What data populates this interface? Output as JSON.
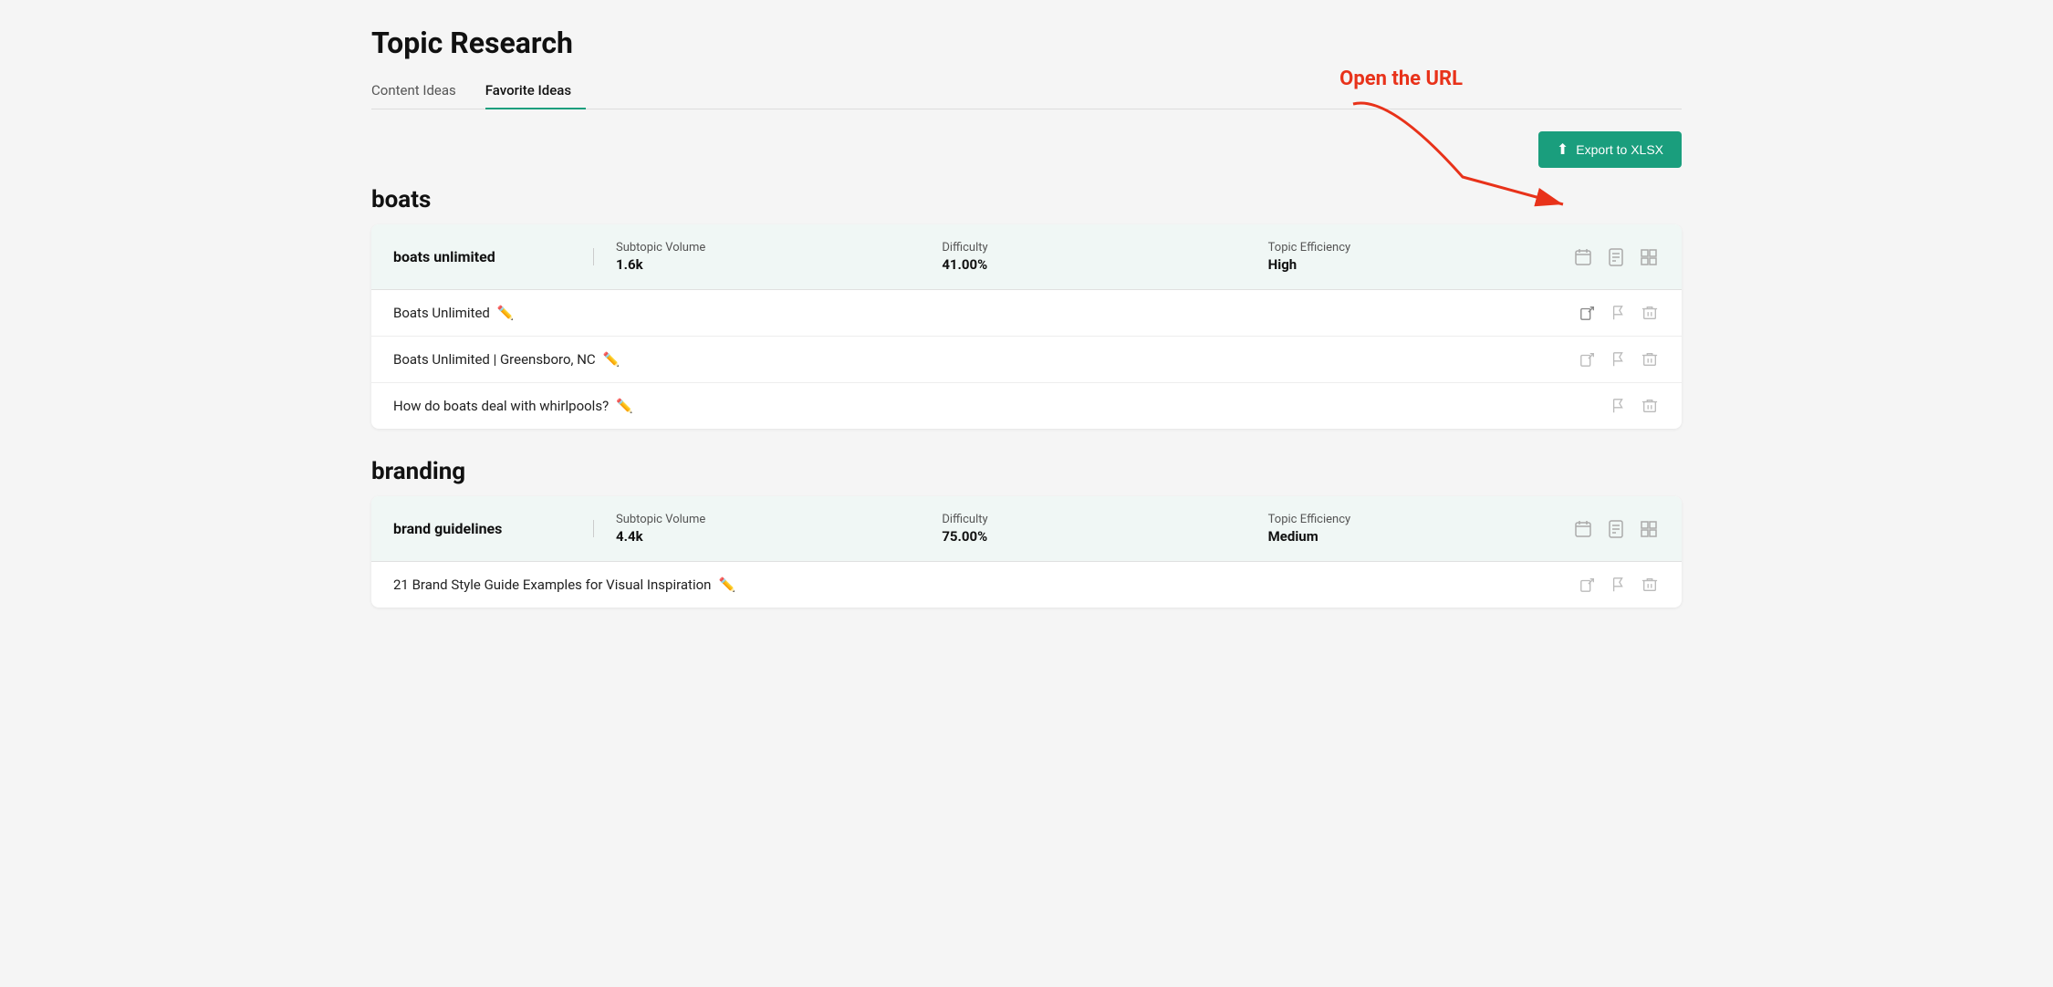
{
  "page": {
    "title": "Topic Research",
    "tabs": [
      {
        "label": "Content Ideas",
        "active": false
      },
      {
        "label": "Favorite Ideas",
        "active": true
      }
    ],
    "toolbar": {
      "export_label": "Export to XLSX"
    },
    "annotation": {
      "text": "Open the URL"
    }
  },
  "sections": [
    {
      "id": "boats",
      "title": "boats",
      "header": {
        "topic_name": "boats unlimited",
        "subtopic_volume_label": "Subtopic Volume",
        "subtopic_volume_value": "1.6k",
        "difficulty_label": "Difficulty",
        "difficulty_value": "41.00%",
        "efficiency_label": "Topic Efficiency",
        "efficiency_value": "High"
      },
      "rows": [
        {
          "title": "Boats Unlimited",
          "has_url": true,
          "has_flag": true,
          "has_delete": true,
          "highlight": true
        },
        {
          "title": "Boats Unlimited | Greensboro, NC",
          "has_url": true,
          "has_flag": true,
          "has_delete": true
        },
        {
          "title": "How do boats deal with whirlpools?",
          "has_url": false,
          "has_flag": true,
          "has_delete": true
        }
      ]
    },
    {
      "id": "branding",
      "title": "branding",
      "header": {
        "topic_name": "brand guidelines",
        "subtopic_volume_label": "Subtopic Volume",
        "subtopic_volume_value": "4.4k",
        "difficulty_label": "Difficulty",
        "difficulty_value": "75.00%",
        "efficiency_label": "Topic Efficiency",
        "efficiency_value": "Medium"
      },
      "rows": [
        {
          "title": "21 Brand Style Guide Examples for Visual Inspiration",
          "has_url": true,
          "has_flag": true,
          "has_delete": true
        }
      ]
    }
  ]
}
